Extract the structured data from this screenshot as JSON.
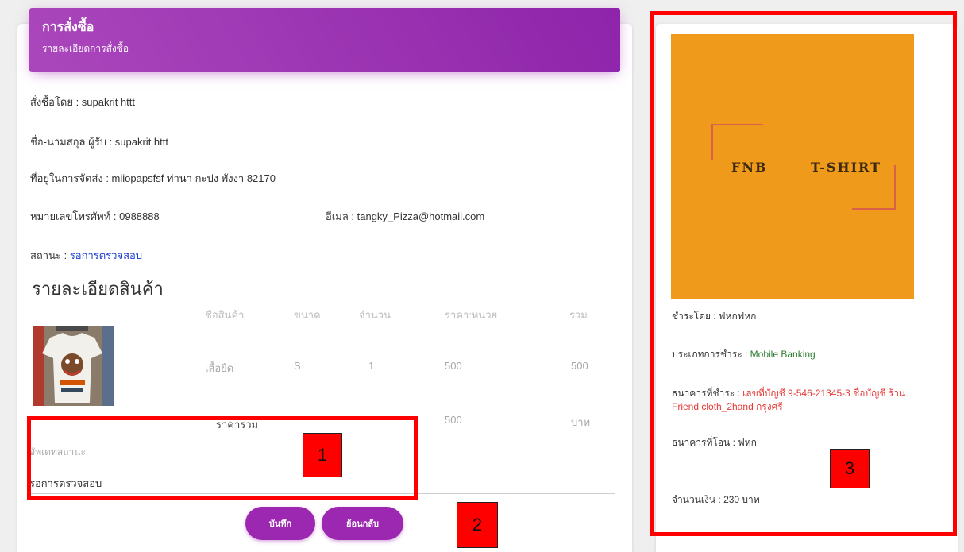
{
  "order_card": {
    "title": "การสั่งซื้อ",
    "subtitle": "รายละเอียดการสั่งซื้อ",
    "ordered_by": "สั่งซื้อโดย : supakrit httt",
    "recipient": "ชื่อ-นามสกุล ผู้รับ : supakrit httt",
    "address": "ที่อยู่ในการจัดส่ง : miiopapsfsf ท่านา กะปง พังงา 82170",
    "phone": "หมายเลขโทรศัพท์ : 0988888",
    "email": "อีเมล : tangky_Pizza@hotmail.com",
    "status_label": "สถานะ : ",
    "status_value": "รอการตรวจสอบ"
  },
  "product_section": {
    "title": "รายละเอียดสินค้า",
    "headers": {
      "name": "ชื่อสินค้า",
      "size": "ขนาด",
      "qty": "จำนวน",
      "unit_price": "ราคา:หน่วย",
      "total": "รวม"
    },
    "rows": [
      {
        "name": "เสื้อยืด",
        "size": "S",
        "qty": "1",
        "unit_price": "500",
        "total": "500"
      }
    ],
    "grand_total_label": "ราคารวม",
    "grand_total_value": "500",
    "currency": "บาท"
  },
  "update_status": {
    "label": "อัพเดทสถานะ",
    "value": "รอการตรวจสอบ"
  },
  "buttons": {
    "save": "บันทึก",
    "back": "ย้อนกลับ"
  },
  "payment_card": {
    "logo_text_left": "FNB",
    "logo_text_right": "T-SHIRT",
    "paid_by": "ชำระโดย : ฟหกฟหก",
    "payment_type_label": "ประเภทการชำระ : ",
    "payment_type_value": "Mobile Banking",
    "bank_label": "ธนาคารที่ชำระ : ",
    "bank_value_line1": "เลขที่บัญชี 9-546-21345-3 ชื่อบัญชี ร้าน",
    "bank_value_line2": "Friend cloth_2hand กรุงศรี",
    "transfer_bank": "ธนาคารที่โอน : ฟหก",
    "amount": "จำนวนเงิน : 230 บาท"
  },
  "annotations": {
    "one": "1",
    "two": "2",
    "three": "3"
  },
  "colors": {
    "header_purple": "#9c27b0",
    "annotation_red": "#ff0000",
    "logo_orange": "#ef9a1b",
    "status_blue": "#1a3dd1",
    "payment_green": "#2e7d32",
    "bank_red": "#e53935"
  }
}
